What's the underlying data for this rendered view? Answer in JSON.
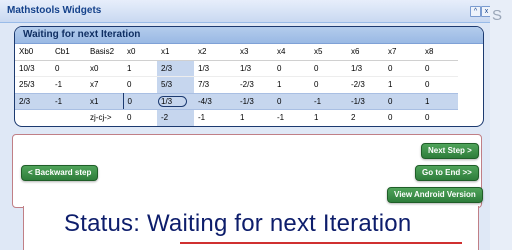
{
  "window": {
    "title": "Mathstools Widgets",
    "btn_collapse": "^",
    "btn_close": "x"
  },
  "side_glyph": "S",
  "panel": {
    "title": "Waiting for next Iteration",
    "columns": [
      "Xb0",
      "Cb1",
      "Basis2",
      "x0",
      "x1",
      "x2",
      "x3",
      "x4",
      "x5",
      "x6",
      "x7",
      "x8"
    ],
    "rows": [
      [
        "10/3",
        "0",
        "x0",
        "1",
        "2/3",
        "1/3",
        "1/3",
        "0",
        "0",
        "1/3",
        "0",
        "0"
      ],
      [
        "25/3",
        "-1",
        "x7",
        "0",
        "5/3",
        "7/3",
        "-2/3",
        "1",
        "0",
        "-2/3",
        "1",
        "0"
      ],
      [
        "2/3",
        "-1",
        "x1",
        "0",
        "1/3",
        "-4/3",
        "-1/3",
        "0",
        "-1",
        "-1/3",
        "0",
        "1"
      ],
      [
        "",
        "",
        "zj-cj->",
        "0",
        "-2",
        "-1",
        "1",
        "-1",
        "1",
        "2",
        "0",
        "0"
      ]
    ]
  },
  "buttons": {
    "backward": "< Backward step",
    "next": "Next Step >",
    "go_end": "Go to End >>",
    "android": "View Android Version"
  },
  "status": "Status: Waiting for next Iteration"
}
